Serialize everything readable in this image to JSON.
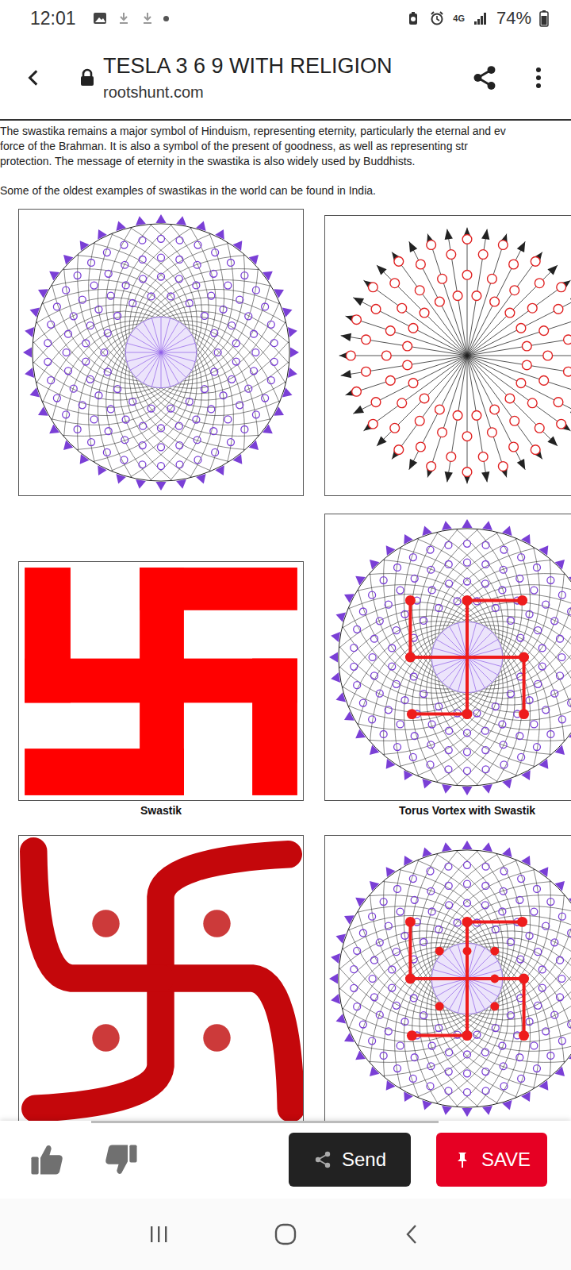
{
  "status_bar": {
    "time": "12:01",
    "network": "4G",
    "battery": "74%"
  },
  "browser": {
    "title": "TESLA 3 6 9 WITH RELIGION",
    "url": "rootshunt.com",
    "secure": true
  },
  "article": {
    "paragraphs": [
      [
        "The swastika remains a major symbol of Hinduism, representing eternity, particularly the eternal and ev",
        "force of the Brahman. It is also a symbol of the present of goodness, as well as representing str",
        "protection. The message of eternity in the swastika is also widely used by Buddhists."
      ],
      [
        "Some of the oldest examples of swastikas in the world can be found in India."
      ]
    ]
  },
  "gallery": [
    {
      "kind": "torus"
    },
    {
      "kind": "rays"
    },
    {
      "kind": "swastik",
      "caption": "Swastik"
    },
    {
      "kind": "torus-swastik",
      "caption": "Torus Vortex with Swastik"
    },
    {
      "kind": "swastik-dots"
    },
    {
      "kind": "torus-swastik-dots"
    }
  ],
  "actions": {
    "send": "Send",
    "save": "SAVE"
  }
}
